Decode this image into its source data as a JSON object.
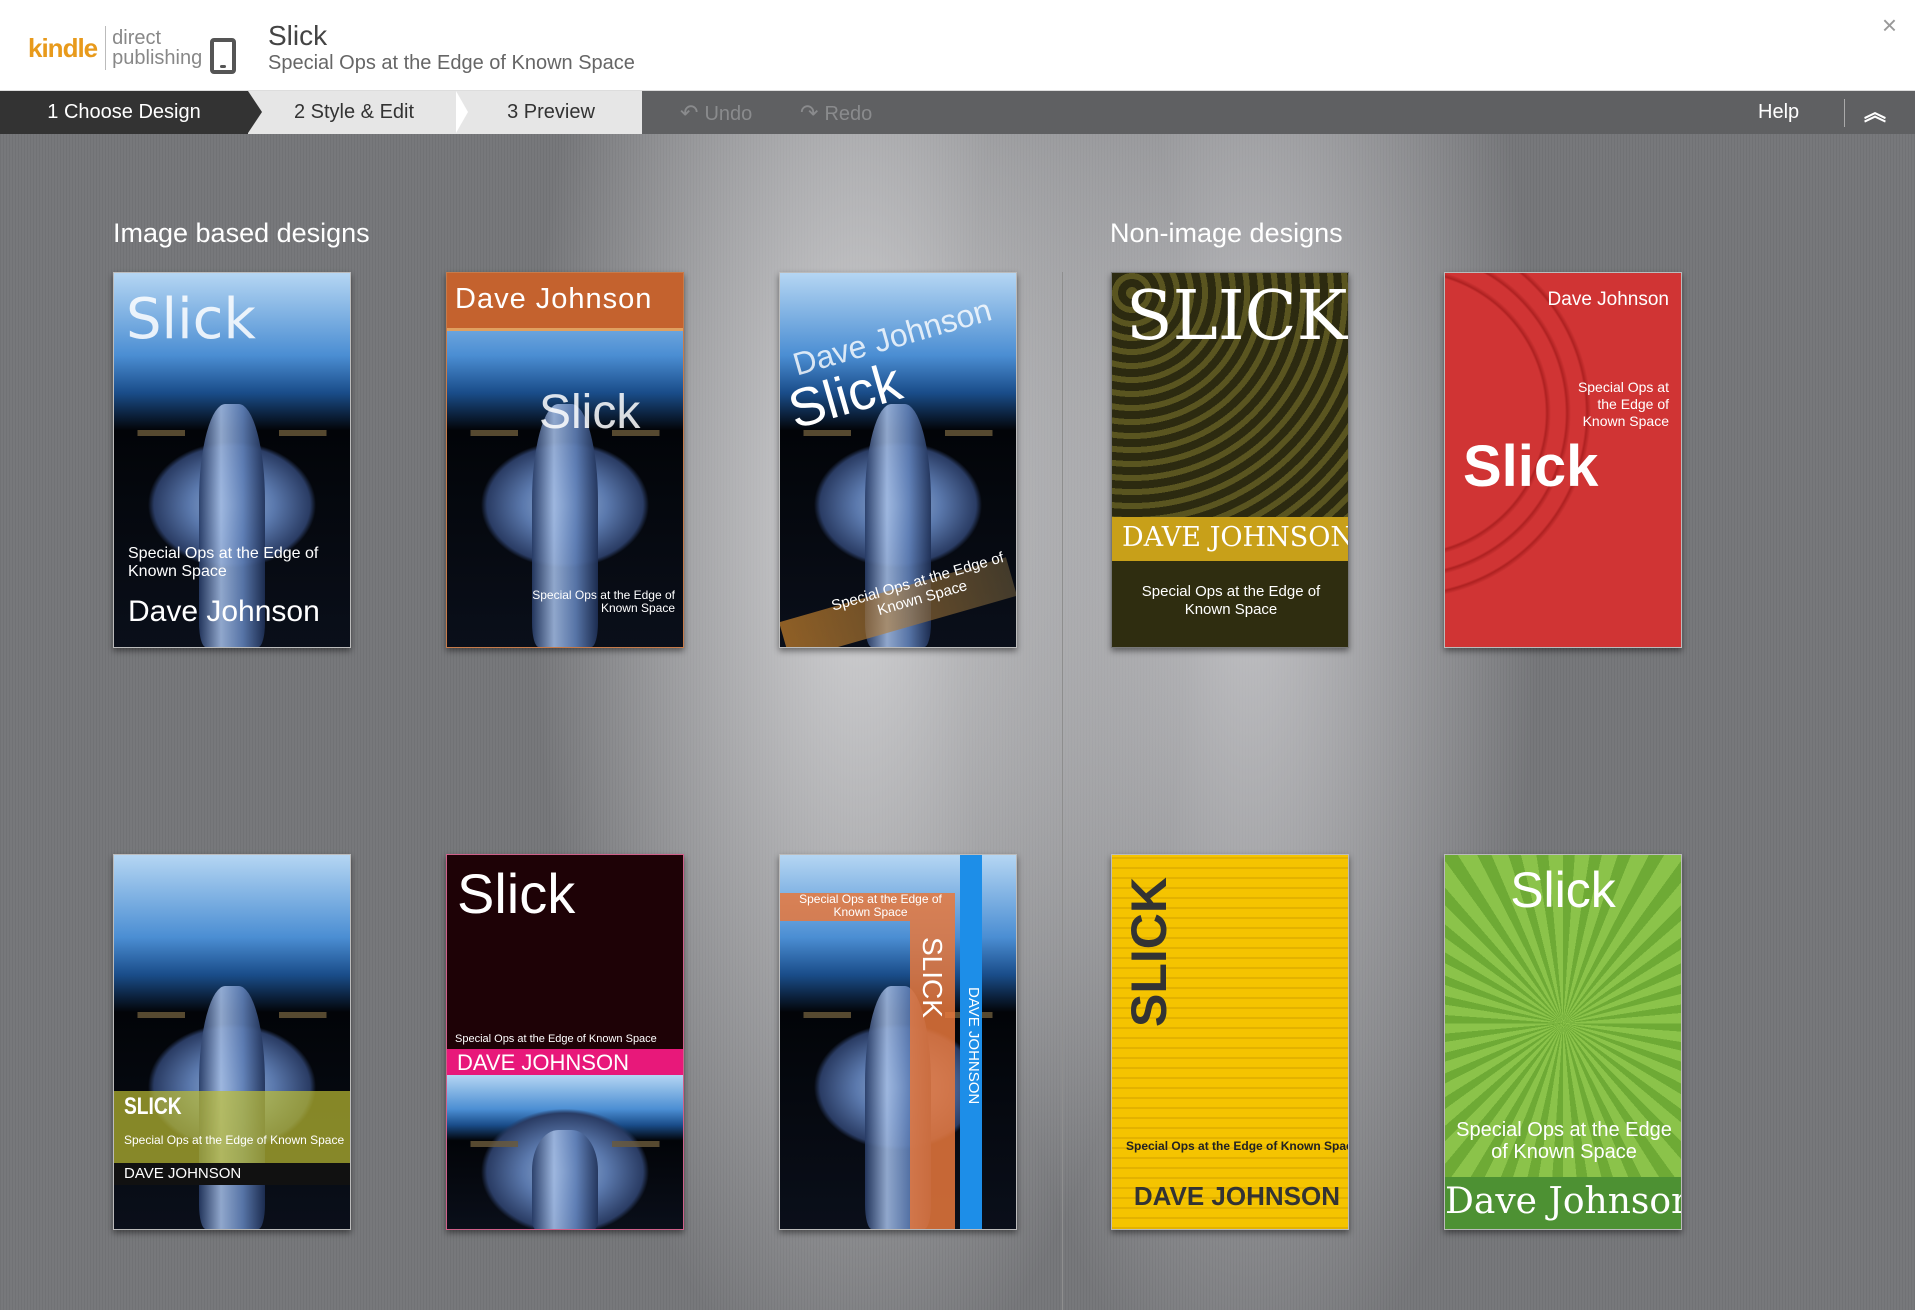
{
  "header": {
    "logo_kindle": "kindle",
    "logo_direct": "direct",
    "logo_publishing": "publishing",
    "title": "Slick",
    "subtitle": "Special Ops at the Edge of Known Space",
    "close": "×"
  },
  "toolbar": {
    "steps": [
      {
        "label": "1 Choose Design"
      },
      {
        "label": "2 Style & Edit"
      },
      {
        "label": "3 Preview"
      }
    ],
    "undo": "Undo",
    "redo": "Redo",
    "help": "Help",
    "collapse": "︽"
  },
  "sections": {
    "image_based": "Image based designs",
    "non_image": "Non-image designs"
  },
  "covers": {
    "c1": {
      "title": "Slick",
      "subtitle": "Special Ops at the Edge of Known Space",
      "author": "Dave Johnson"
    },
    "c2": {
      "title": "Slick",
      "subtitle": "Special Ops at the Edge of Known Space",
      "author": "Dave Johnson"
    },
    "c3": {
      "title": "Slick",
      "subtitle": "Special Ops at the Edge of Known Space",
      "author": "Dave Johnson"
    },
    "c4": {
      "title": "SLICK",
      "subtitle": "Special Ops at the Edge of Known Space",
      "author": "DAVE JOHNSON"
    },
    "c5": {
      "title": "Slick",
      "subtitle": "Special Ops at the Edge of Known Space",
      "author": "Dave Johnson"
    },
    "c6": {
      "title": "SLICK",
      "subtitle": "Special Ops at the Edge of Known Space",
      "author": "DAVE JOHNSON"
    },
    "c7": {
      "title": "Slick",
      "subtitle": "Special Ops at the Edge of Known Space",
      "author": "DAVE JOHNSON"
    },
    "c8": {
      "title": "SLICK",
      "subtitle": "Special Ops at the Edge of Known Space",
      "author": "DAVE JOHNSON"
    },
    "c9": {
      "title": "SLICK",
      "subtitle": "Special Ops at the Edge of Known Space",
      "author": "DAVE JOHNSON"
    },
    "c10": {
      "title": "Slick",
      "subtitle": "Special Ops at the Edge of Known Space",
      "author": "Dave Johnson"
    }
  },
  "colors": {
    "accent_kindle": "#e89a1b",
    "toolbar_bg": "#5f6062",
    "active_step": "#333333"
  }
}
